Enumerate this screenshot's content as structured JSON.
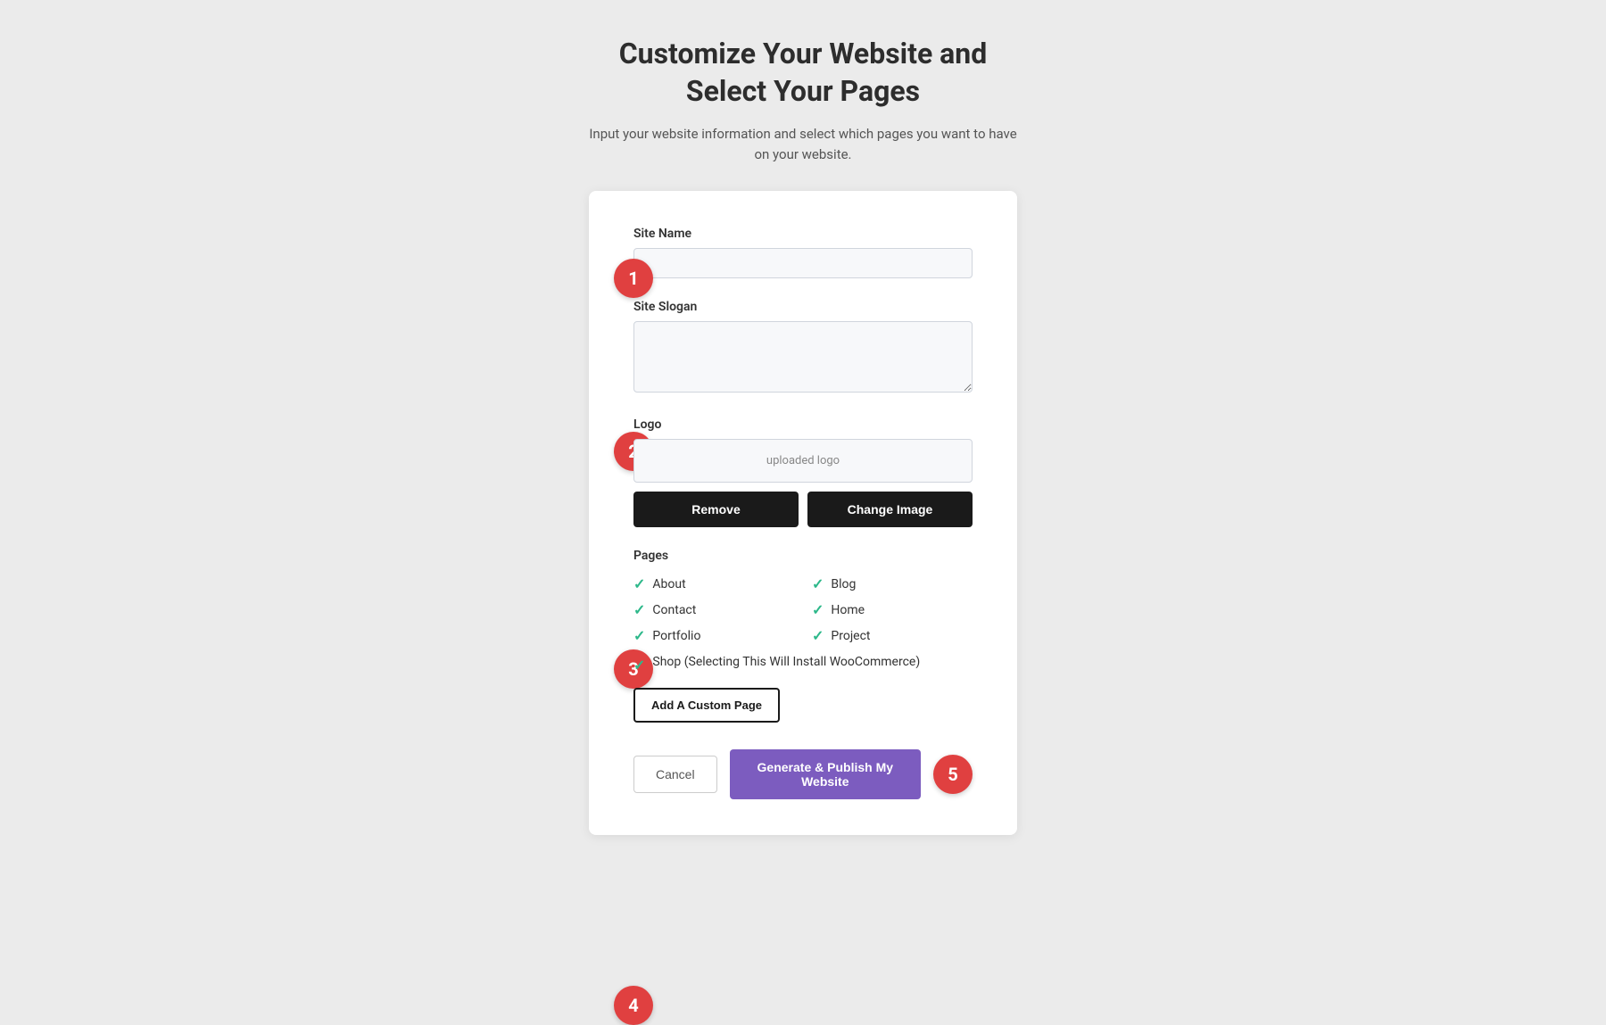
{
  "header": {
    "title": "Customize Your Website and\nSelect Your Pages",
    "subtitle": "Input your website information and select which pages you want to have\non your website."
  },
  "form": {
    "site_name": {
      "label": "Site Name",
      "placeholder": "",
      "value": ""
    },
    "site_slogan": {
      "label": "Site Slogan",
      "placeholder": "",
      "value": ""
    },
    "logo": {
      "label": "Logo",
      "preview_text": "uploaded logo",
      "remove_button": "Remove",
      "change_button": "Change Image"
    },
    "pages": {
      "label": "Pages",
      "items_col1": [
        "About",
        "Contact",
        "Portfolio"
      ],
      "items_col2": [
        "Blog",
        "Home",
        "Project"
      ],
      "shop_item": "Shop (Selecting This Will Install WooCommerce)",
      "add_custom_button": "Add A Custom Page"
    },
    "footer": {
      "cancel_label": "Cancel",
      "publish_label": "Generate & Publish My Website"
    }
  },
  "steps": {
    "badge_1": "1",
    "badge_2": "2",
    "badge_3": "3",
    "badge_4": "4",
    "badge_5": "5"
  }
}
